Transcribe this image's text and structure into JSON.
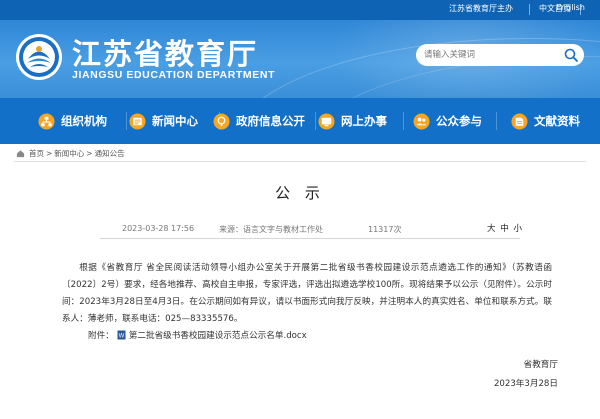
{
  "topbar": {
    "host": "江苏省教育厅主办",
    "lang_cn": "中文首页",
    "lang_en": "English"
  },
  "header": {
    "title_cn": "江苏省教育厅",
    "title_en": "JIANGSU EDUCATION DEPARTMENT",
    "search_placeholder": "请输入关键词",
    "logo_icon": "jiangsu-education-emblem",
    "search_icon": "search-icon"
  },
  "nav": {
    "items": [
      {
        "label": "组织机构",
        "icon": "org-chart-icon"
      },
      {
        "label": "新闻中心",
        "icon": "news-icon"
      },
      {
        "label": "政府信息公开",
        "icon": "gov-info-icon"
      },
      {
        "label": "网上办事",
        "icon": "online-service-icon"
      },
      {
        "label": "公众参与",
        "icon": "public-participation-icon"
      },
      {
        "label": "文献资料",
        "icon": "documents-icon"
      }
    ]
  },
  "breadcrumb": {
    "home": "首页",
    "sep": ">",
    "level1": "新闻中心",
    "level2": "通知公告"
  },
  "article": {
    "title": "公 示",
    "date": "2023-03-28 17:56",
    "source": "来源：语言文字与教材工作处",
    "views": "11317次",
    "font_large": "大",
    "font_medium": "中",
    "font_small": "小",
    "paragraph": "根据《省教育厅 省全民阅读活动领导小组办公室关于开展第二批省级书香校园建设示范点遴选工作的通知》（苏教语函〔2022〕2号）要求，经各地推荐、高校自主申报，专家评选，评选出拟遴选学校100所。现将结果予以公示（见附件）。公示时间：2023年3月28日至4月3日。在公示期间如有异议，请以书面形式向我厅反映，并注明本人的真实姓名、单位和联系方式。联系人：薄老师，联系电话：025—83335576。",
    "attachment_label": "附件：",
    "attachment_file": "第二批省级书香校园建设示范点公示名单.docx",
    "signature": "省教育厅",
    "signature_date": "2023年3月28日"
  },
  "colors": {
    "top_strip": "#0e63b5",
    "banner": "#3b8fd8",
    "nav": "#1370c8",
    "icon_orange": "#f6a623"
  }
}
